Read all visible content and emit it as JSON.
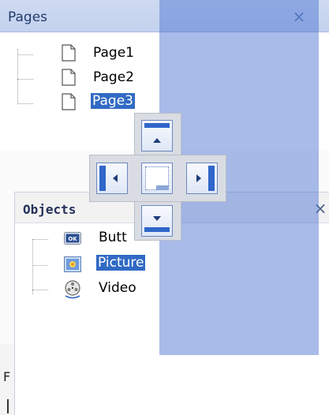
{
  "pages_panel": {
    "title": "Pages",
    "close_symbol": "×",
    "items": [
      {
        "label": "Page1",
        "icon": "page-icon",
        "selected": false
      },
      {
        "label": "Page2",
        "icon": "page-icon",
        "selected": false
      },
      {
        "label": "Page3",
        "icon": "page-icon",
        "selected": true
      }
    ]
  },
  "objects_panel": {
    "title": "Objects",
    "close_symbol": "×",
    "items": [
      {
        "label": "Butt",
        "icon": "ok-button-icon",
        "selected": false
      },
      {
        "label": "Picture",
        "icon": "picture-icon",
        "selected": true
      },
      {
        "label": "Video",
        "icon": "film-reel-icon",
        "selected": false
      }
    ]
  },
  "background_panel": {
    "letter": "F"
  },
  "dock_guide": {
    "buttons": [
      "dock-top",
      "dock-left",
      "dock-center",
      "dock-right",
      "dock-bottom"
    ]
  },
  "colors": {
    "selection": "#316ac5",
    "dock_preview": "#4a70d2",
    "header_blue": "#c3d2ee"
  }
}
